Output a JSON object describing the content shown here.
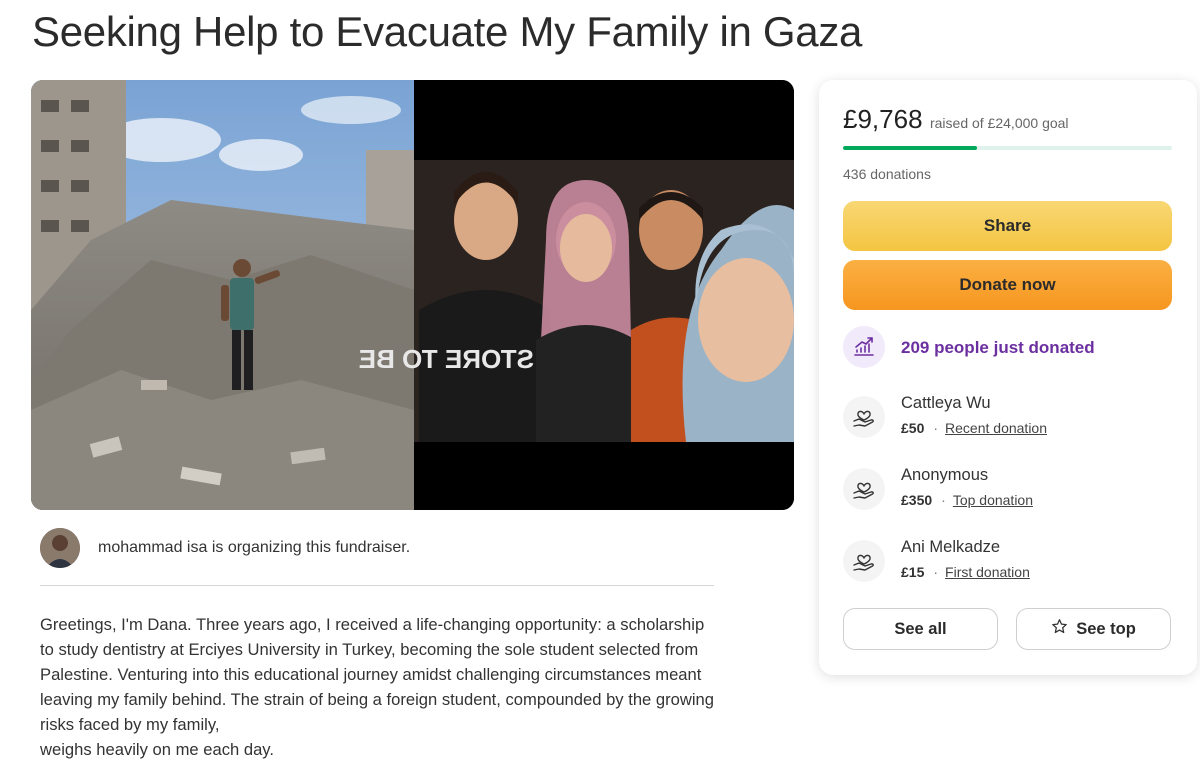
{
  "page": {
    "title": "Seeking Help to Evacuate My Family in Gaza"
  },
  "hero": {
    "shirt_text": "STORE TO BE"
  },
  "organizer": {
    "text": "mohammad isa is organizing this fundraiser."
  },
  "story": {
    "paragraph": "Greetings, I'm Dana. Three years ago, I received a life-changing opportunity: a scholarship to study dentistry at Erciyes University in Turkey, becoming the sole student selected from Palestine. Venturing into this educational journey amidst challenging circumstances meant leaving my family behind. The strain of being a foreign student, compounded by the growing risks faced by my family,",
    "last_line": "weighs heavily on me each day."
  },
  "donation_card": {
    "raised_amount": "£9,768",
    "goal_text": "raised of £24,000 goal",
    "progress_fraction": 0.407,
    "donations_count": "436 donations",
    "share_label": "Share",
    "donate_label": "Donate now",
    "just_donated": "209 people just donated",
    "donors": [
      {
        "name": "Cattleya Wu",
        "amount": "£50",
        "separator": "·",
        "tag": "Recent donation"
      },
      {
        "name": "Anonymous",
        "amount": "£350",
        "separator": "·",
        "tag": "Top donation"
      },
      {
        "name": "Ani Melkadze",
        "amount": "£15",
        "separator": "·",
        "tag": "First donation"
      }
    ],
    "see_all_label": "See all",
    "see_top_label": "See top"
  },
  "colors": {
    "progress_green": "#02a95c",
    "share_yellow": "#f4c542",
    "donate_orange": "#f6961f",
    "trend_purple": "#6b2fa0"
  },
  "icons": {
    "trend": "trending-up-icon",
    "donor": "heart-hand-icon",
    "star": "star-icon"
  }
}
